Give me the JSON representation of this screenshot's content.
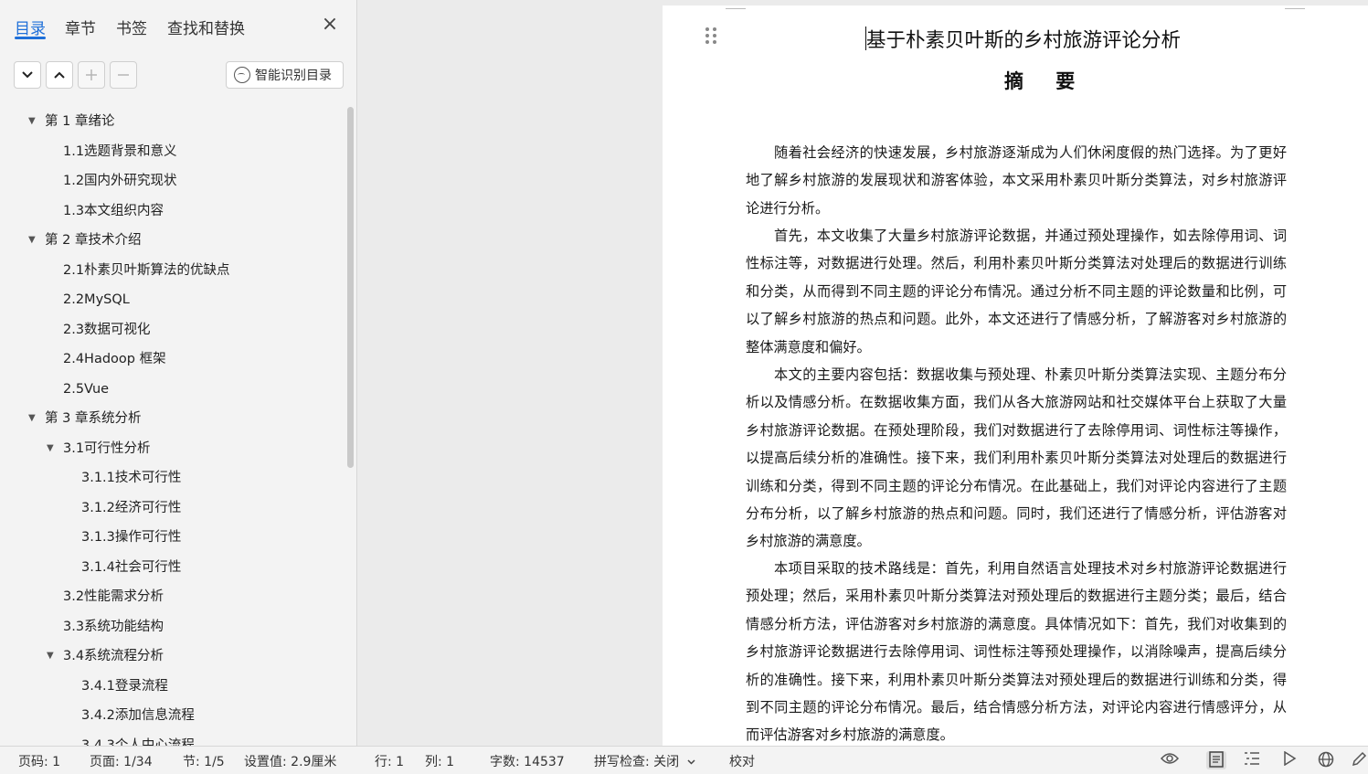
{
  "sidebar": {
    "tabs": [
      "目录",
      "章节",
      "书签",
      "查找和替换"
    ],
    "active_tab": "目录",
    "smart_toc_label": "智能识别目录",
    "toc": [
      {
        "label": "第 1 章绪论",
        "level": 0,
        "expanded": true
      },
      {
        "label": "1.1选题背景和意义",
        "level": 1
      },
      {
        "label": "1.2国内外研究现状",
        "level": 1
      },
      {
        "label": "1.3本文组织内容",
        "level": 1
      },
      {
        "label": "第 2 章技术介绍",
        "level": 0,
        "expanded": true
      },
      {
        "label": "2.1朴素贝叶斯算法的优缺点",
        "level": 1
      },
      {
        "label": "2.2MySQL",
        "level": 1
      },
      {
        "label": "2.3数据可视化",
        "level": 1
      },
      {
        "label": "2.4Hadoop 框架",
        "level": 1
      },
      {
        "label": "2.5Vue",
        "level": 1
      },
      {
        "label": "第 3 章系统分析",
        "level": 0,
        "expanded": true
      },
      {
        "label": "3.1可行性分析",
        "level": 1,
        "expanded": true
      },
      {
        "label": "3.1.1技术可行性",
        "level": 2
      },
      {
        "label": "3.1.2经济可行性",
        "level": 2
      },
      {
        "label": "3.1.3操作可行性",
        "level": 2
      },
      {
        "label": "3.1.4社会可行性",
        "level": 2
      },
      {
        "label": "3.2性能需求分析",
        "level": 1
      },
      {
        "label": "3.3系统功能结构",
        "level": 1
      },
      {
        "label": "3.4系统流程分析",
        "level": 1,
        "expanded": true
      },
      {
        "label": "3.4.1登录流程",
        "level": 2
      },
      {
        "label": "3.4.2添加信息流程",
        "level": 2
      },
      {
        "label": "3.4.3个人中心流程",
        "level": 2
      }
    ]
  },
  "document": {
    "title": "基于朴素贝叶斯的乡村旅游评论分析",
    "subtitle": "摘  要",
    "paragraphs": [
      "随着社会经济的快速发展，乡村旅游逐渐成为人们休闲度假的热门选择。为了更好地了解乡村旅游的发展现状和游客体验，本文采用朴素贝叶斯分类算法，对乡村旅游评论进行分析。",
      "首先，本文收集了大量乡村旅游评论数据，并通过预处理操作，如去除停用词、词性标注等，对数据进行处理。然后，利用朴素贝叶斯分类算法对处理后的数据进行训练和分类，从而得到不同主题的评论分布情况。通过分析不同主题的评论数量和比例，可以了解乡村旅游的热点和问题。此外，本文还进行了情感分析，了解游客对乡村旅游的整体满意度和偏好。",
      "本文的主要内容包括：数据收集与预处理、朴素贝叶斯分类算法实现、主题分布分析以及情感分析。在数据收集方面，我们从各大旅游网站和社交媒体平台上获取了大量乡村旅游评论数据。在预处理阶段，我们对数据进行了去除停用词、词性标注等操作，以提高后续分析的准确性。接下来，我们利用朴素贝叶斯分类算法对处理后的数据进行训练和分类，得到不同主题的评论分布情况。在此基础上，我们对评论内容进行了主题分布分析，以了解乡村旅游的热点和问题。同时，我们还进行了情感分析，评估游客对乡村旅游的满意度。",
      "本项目采取的技术路线是：首先，利用自然语言处理技术对乡村旅游评论数据进行预处理；然后，采用朴素贝叶斯分类算法对预处理后的数据进行主题分类；最后，结合情感分析方法，评估游客对乡村旅游的满意度。具体情况如下：首先，我们对收集到的乡村旅游评论数据进行去除停用词、词性标注等预处理操作，以消除噪声，提高后续分析的准确性。接下来，利用朴素贝叶斯分类算法对预处理后的数据进行训练和分类，得到不同主题的评论分布情况。最后，结合情感分析方法，对评论内容进行情感评分，从而评估游客对乡村旅游的满意度。"
    ]
  },
  "statusbar": {
    "page_code": "页码: 1",
    "page": "页面: 1/34",
    "section": "节: 1/5",
    "setting": "设置值: 2.9厘米",
    "row": "行: 1",
    "col": "列: 1",
    "word_count": "字数: 14537",
    "spell_check": "拼写检查: 关闭",
    "proofread": "校对"
  },
  "icons": {
    "expand_all": "chevron-down-icon",
    "collapse_all": "chevron-up-icon",
    "add": "plus-icon",
    "remove": "minus-icon",
    "close": "close-icon",
    "eye": "eye-icon",
    "page_view": "page-view-icon",
    "outline_view": "outline-view-icon",
    "play": "play-icon",
    "globe": "globe-icon",
    "pen": "pen-icon"
  },
  "colors": {
    "accent": "#1e6fd9"
  }
}
